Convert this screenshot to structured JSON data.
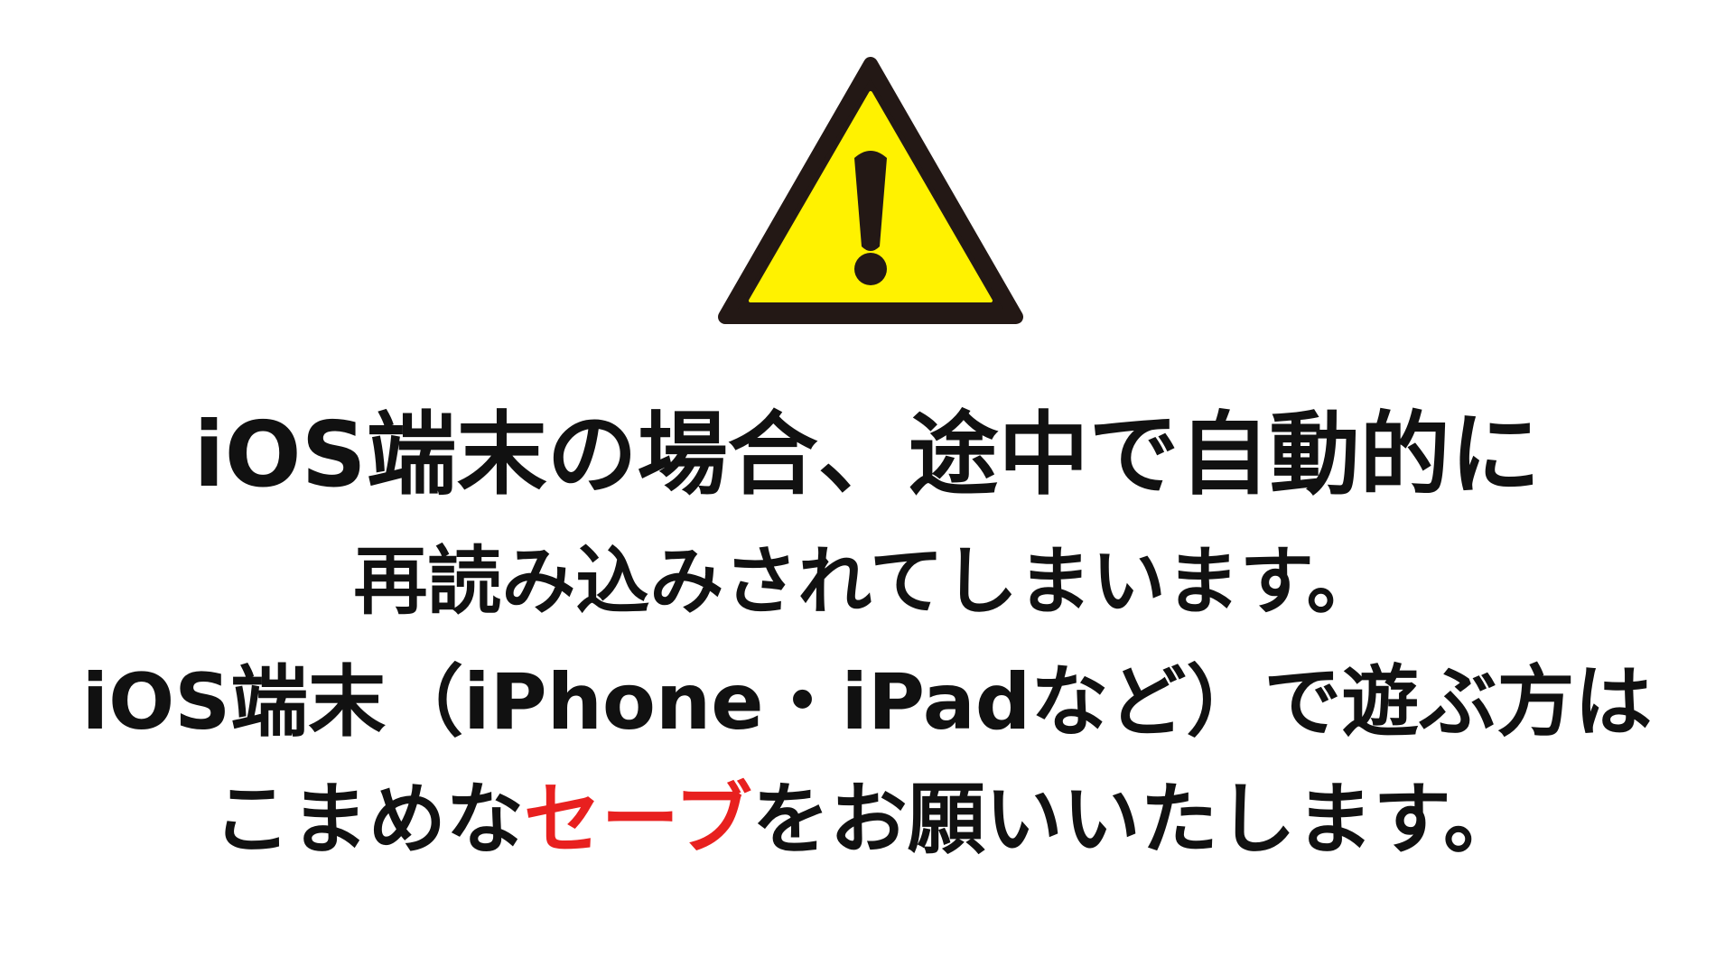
{
  "icon": {
    "name": "warning-triangle-icon",
    "mark": "!",
    "fill_color": "#fff200",
    "outline_color": "#231815"
  },
  "message": {
    "line1": "iOS端末の場合、途中で自動的に",
    "line2": "再読み込みされてしまいます。",
    "line3": "iOS端末（iPhone・iPadなど）で遊ぶ方は",
    "line4_before": "こまめな",
    "line4_highlight": "セーブ",
    "line4_after": "をお願いいたします。",
    "text_color": "#111111",
    "highlight_color": "#e8201f"
  }
}
